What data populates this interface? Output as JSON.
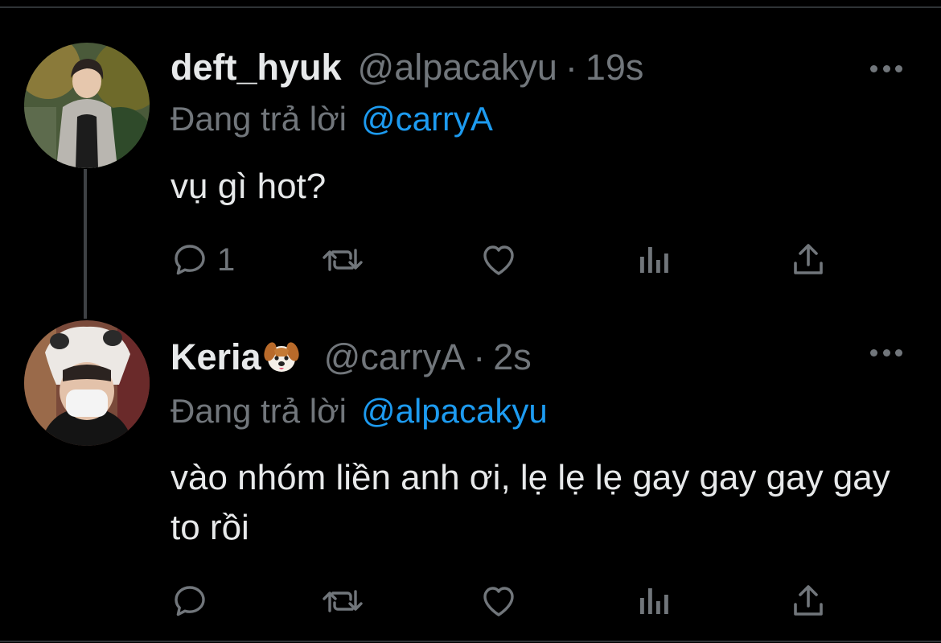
{
  "tweets": [
    {
      "display_name": "deft_hyuk",
      "handle": "@alpacakyu",
      "separator": "·",
      "time": "19s",
      "reply_prefix": "Đang trả lời",
      "reply_to": "@carryA",
      "text": "vụ gì hot?",
      "reply_count": "1",
      "has_emoji": false
    },
    {
      "display_name": "Keria",
      "display_emoji": "dog-face-emoji",
      "handle": "@carryA",
      "separator": "·",
      "time": "2s",
      "reply_prefix": "Đang trả lời",
      "reply_to": "@alpacakyu",
      "text": "vào nhóm liền anh ơi, lẹ lẹ lẹ gay gay gay gay to rồi",
      "reply_count": "",
      "has_emoji": true
    }
  ],
  "icons": {
    "reply": "reply-icon",
    "retweet": "retweet-icon",
    "like": "heart-icon",
    "views": "analytics-icon",
    "share": "share-icon",
    "more": "more-icon"
  },
  "colors": {
    "background": "#000000",
    "text_primary": "#e7e9ea",
    "text_secondary": "#71767b",
    "link": "#1d9bf0",
    "divider": "#2f3336"
  }
}
